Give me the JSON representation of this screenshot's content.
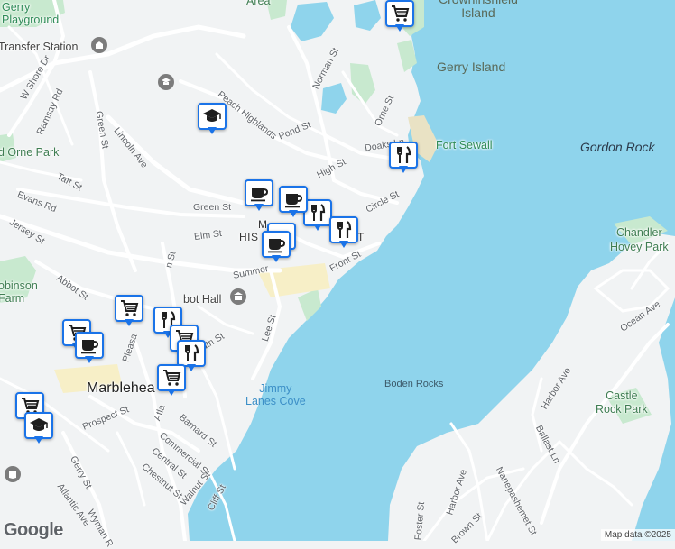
{
  "map": {
    "water_color": "#8fd4ec",
    "land_color": "#f1f3f4",
    "park_color": "#c8e9cf",
    "road_color": "#ffffff",
    "marker_color": "#1a73e8",
    "attribution": "Map data ©2025",
    "logo": "Google"
  },
  "labels": {
    "gerry_playground": "Gerry\nPlayground",
    "transfer_station": "Transfer Station",
    "w_shore_dr": "W Shore Dr",
    "ramsay_rd": "Ramsay Rd",
    "green_st_v": "Green St",
    "lincoln_ave": "Lincoln Ave",
    "orne_park": "d Orne Park",
    "taft_st": "Taft St",
    "evans_rd": "Evans Rd",
    "jersey_st": "Jersey St",
    "abbot_st": "Abbot St",
    "robinson_farm": "obinson\nFarm",
    "area": "Area",
    "norman_st": "Norman St",
    "peach_highlands": "Peach Highlands",
    "pond_st": "Pond St",
    "orne_st": "Orne St",
    "doaks_ln": "Doaks Ln",
    "high_st": "High St",
    "green_st": "Green St",
    "elm_st": "Elm St",
    "circle_st": "Circle St",
    "historic": "HIS",
    "historic_t": "T",
    "m_letter": "M",
    "summer": "Summer",
    "front_st": "Front St",
    "abbot_hall": "bot Hall",
    "pleasant": "Pleasa",
    "south_st": "uth St",
    "lee_st": "Lee St",
    "washington": "n St",
    "marblehead": "Marbleheа",
    "atlantic": "Atla",
    "barnard_st": "Barnard St",
    "commercial_st": "Commercial St",
    "central_st": "Central St",
    "chestnut_st": "Chestnut St",
    "walnut_st": "Walnut St",
    "cliff_st": "Cliff St",
    "prospect_st": "Prospect St",
    "gerry_st": "Gerry St",
    "atlantic_ave": "Atlantic Ave",
    "wyman_rd": "Wyman R",
    "brown_st": "Brown St",
    "foster_st": "Foster St",
    "harbor_ave_1": "Harbor Ave",
    "harbor_ave_2": "Harbor Ave",
    "nanepashemet_st": "Nanepashemet St",
    "ballast_ln": "Ballast Ln",
    "ocean_ave": "Ocean Ave",
    "ninth": "",
    "crowninshield": "Crowninshield\nIsland",
    "gerry_island": "Gerry Island",
    "fort_sewall": "Fort Sewall",
    "gordon_rock": "Gordon Rock",
    "chandler_hovey": "Chandler\nHovey Park",
    "boden_rocks": "Boden Rocks",
    "jimmy_lanes": "Jimmy\nLanes Cove",
    "castle_rock": "Castle\nRock Park"
  },
  "markers": [
    {
      "name": "shopping-cart",
      "icon": "cart"
    },
    {
      "name": "school",
      "icon": "school"
    },
    {
      "name": "cafe",
      "icon": "cup"
    },
    {
      "name": "restaurant",
      "icon": "fork"
    },
    {
      "name": "cafe",
      "icon": "cup"
    },
    {
      "name": "restaurant",
      "icon": "fork"
    },
    {
      "name": "restaurant",
      "icon": "fork"
    },
    {
      "name": "cafe",
      "icon": "cup"
    },
    {
      "name": "cafe",
      "icon": "cup"
    },
    {
      "name": "shopping-cart",
      "icon": "cart"
    },
    {
      "name": "restaurant",
      "icon": "fork"
    },
    {
      "name": "shopping-cart",
      "icon": "cart"
    },
    {
      "name": "restaurant",
      "icon": "fork"
    },
    {
      "name": "shopping-cart",
      "icon": "cart"
    },
    {
      "name": "cafe",
      "icon": "cup"
    },
    {
      "name": "shopping-cart",
      "icon": "cart"
    },
    {
      "name": "shopping-cart",
      "icon": "cart"
    },
    {
      "name": "school",
      "icon": "school"
    }
  ]
}
